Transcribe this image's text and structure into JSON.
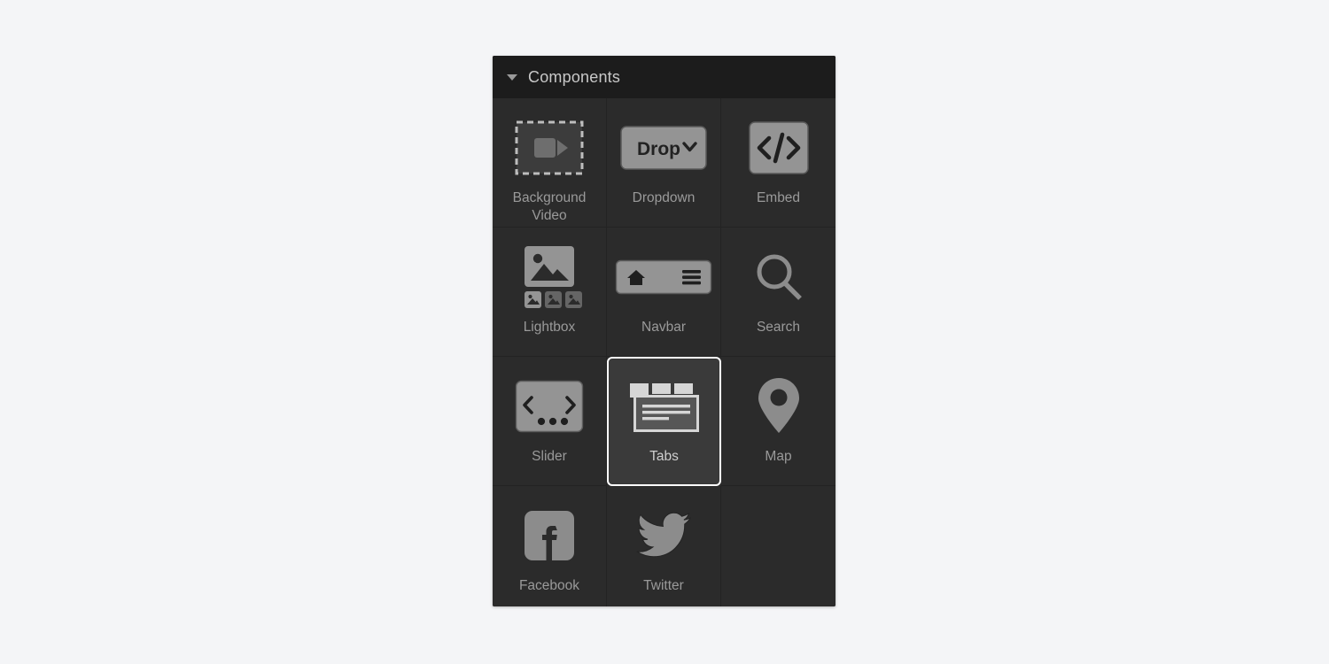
{
  "panel": {
    "title": "Components",
    "expanded": true,
    "disclosure_icon": "triangle-down-icon",
    "background_color": "#2b2b2b",
    "header_background_color": "#1c1c1c",
    "selection_outline_color": "#ffffff",
    "label_color": "#9a9a9a",
    "icon_color": "#8c8c8c"
  },
  "page": {
    "background_color": "#f4f5f7"
  },
  "components": [
    {
      "id": "background-video",
      "label": "Background Video",
      "icon": "background-video-icon",
      "selected": false
    },
    {
      "id": "dropdown",
      "label": "Dropdown",
      "icon": "dropdown-icon",
      "selected": false,
      "icon_text": "Drop"
    },
    {
      "id": "embed",
      "label": "Embed",
      "icon": "embed-code-icon",
      "selected": false,
      "icon_text": "</>"
    },
    {
      "id": "lightbox",
      "label": "Lightbox",
      "icon": "lightbox-icon",
      "selected": false
    },
    {
      "id": "navbar",
      "label": "Navbar",
      "icon": "navbar-icon",
      "selected": false
    },
    {
      "id": "search",
      "label": "Search",
      "icon": "search-icon",
      "selected": false
    },
    {
      "id": "slider",
      "label": "Slider",
      "icon": "slider-icon",
      "selected": false
    },
    {
      "id": "tabs",
      "label": "Tabs",
      "icon": "tabs-icon",
      "selected": true
    },
    {
      "id": "map",
      "label": "Map",
      "icon": "map-pin-icon",
      "selected": false
    },
    {
      "id": "facebook",
      "label": "Facebook",
      "icon": "facebook-icon",
      "selected": false
    },
    {
      "id": "twitter",
      "label": "Twitter",
      "icon": "twitter-icon",
      "selected": false
    }
  ]
}
